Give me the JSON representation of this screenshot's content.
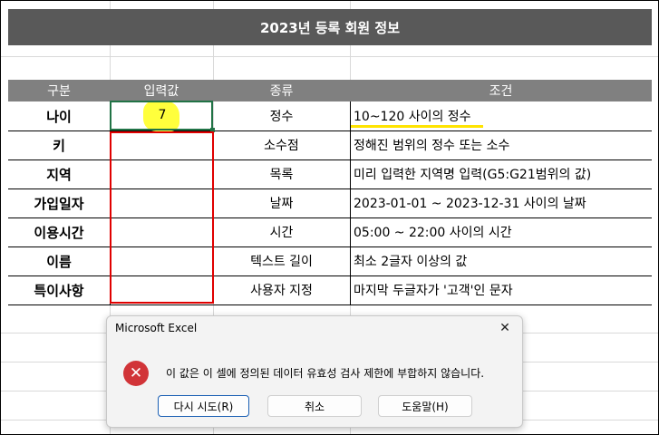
{
  "sheet": {
    "title": "2023년 등록 회원 정보",
    "headers": [
      "구분",
      "입력값",
      "종류",
      "조건"
    ],
    "rows": [
      {
        "name": "나이",
        "input": "7",
        "type": "정수",
        "condition": "10~120 사이의 정수"
      },
      {
        "name": "키",
        "input": "",
        "type": "소수점",
        "condition": "정해진 범위의 정수 또는 소수"
      },
      {
        "name": "지역",
        "input": "",
        "type": "목록",
        "condition": "미리 입력한 지역명 입력(G5:G21범위의 값)"
      },
      {
        "name": "가입일자",
        "input": "",
        "type": "날짜",
        "condition": "2023-01-01 ~ 2023-12-31 사이의 날짜"
      },
      {
        "name": "이용시간",
        "input": "",
        "type": "시간",
        "condition": "05:00 ~ 22:00 사이의 시간"
      },
      {
        "name": "이름",
        "input": "",
        "type": "텍스트 길이",
        "condition": "최소 2글자 이상의 값"
      },
      {
        "name": "특이사항",
        "input": "",
        "type": "사용자 지정",
        "condition": "마지막 두글자가 '고객'인 문자"
      }
    ]
  },
  "dialog": {
    "title": "Microsoft Excel",
    "close": "✕",
    "icon": "error-icon",
    "icon_glyph": "✕",
    "message": "이 값은 이 셀에 정의된 데이터 유효성 검사 제한에 부합하지 않습니다.",
    "buttons": {
      "retry": "다시 시도(R)",
      "cancel": "취소",
      "help": "도움말(H)"
    }
  },
  "colors": {
    "title_bg": "#595959",
    "header_bg": "#808080",
    "highlight": "#ffff3c",
    "red_box": "#e00000",
    "active_cell": "#217346",
    "error": "#d13438"
  }
}
